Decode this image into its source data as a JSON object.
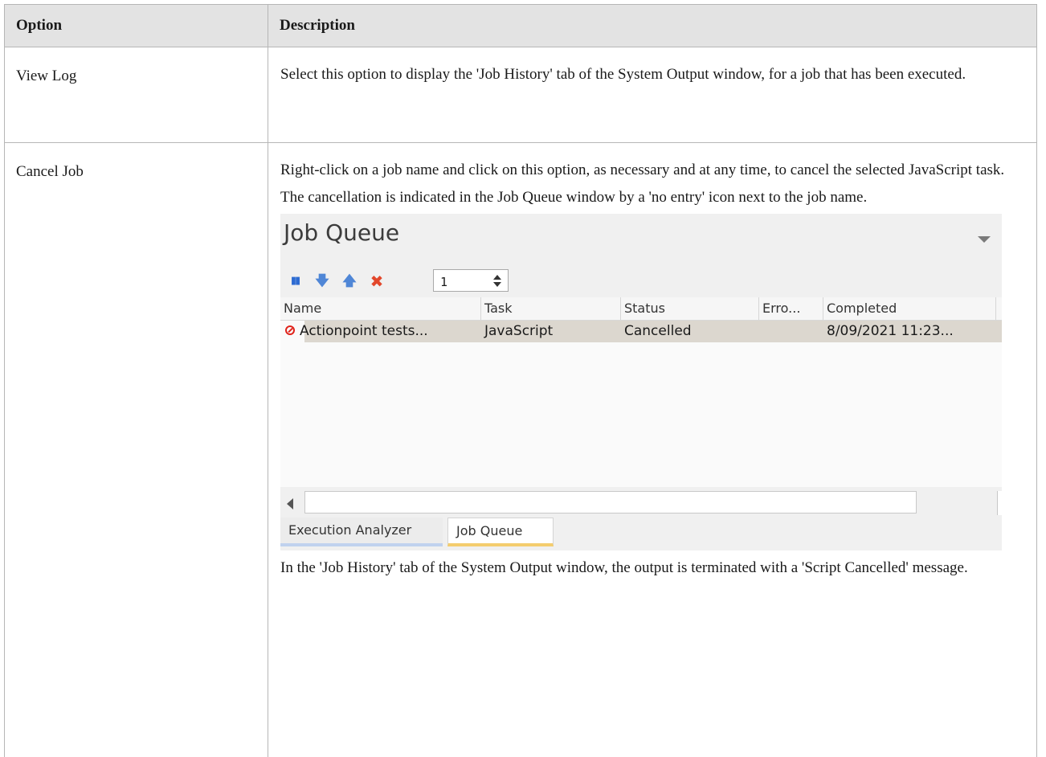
{
  "table": {
    "headers": {
      "option": "Option",
      "description": "Description"
    },
    "rows": [
      {
        "option": "View Log",
        "description": "Select this option to display the 'Job History' tab of the System Output window, for a job that has been executed."
      },
      {
        "option": "Cancel Job",
        "paragraph1": "Right-click on a job name and click on this option, as necessary and at any time, to cancel the selected JavaScript task.",
        "paragraph2": "The cancellation is indicated in the Job Queue window by a 'no entry' icon next to the job name.",
        "paragraph3": "In the 'Job History' tab of the System Output window, the output is terminated with a 'Script Cancelled' message."
      }
    ]
  },
  "job_queue": {
    "title": "Job Queue",
    "toolbar": {
      "icons": [
        "pause-icon",
        "move-down-icon",
        "move-up-icon",
        "cancel-icon"
      ],
      "spinner_value": "1"
    },
    "columns": [
      "Name",
      "Task",
      "Status",
      "Erro...",
      "Completed"
    ],
    "rows": [
      {
        "name": "Actionpoint tests...",
        "task": "JavaScript",
        "status": "Cancelled",
        "error": "",
        "completed": "8/09/2021 11:23...",
        "icon": "no-entry-icon"
      }
    ],
    "tabs": [
      "Execution Analyzer",
      "Job Queue"
    ],
    "active_tab": "Job Queue"
  },
  "colors": {
    "header_bg": "#e3e3e3",
    "selected_row": "#dcd7cf",
    "no_entry": "#e0231b",
    "cancel_x": "#e2472b",
    "active_tab_underline": "#f4cd6e",
    "inactive_tab_underline": "#c0d2ee"
  }
}
